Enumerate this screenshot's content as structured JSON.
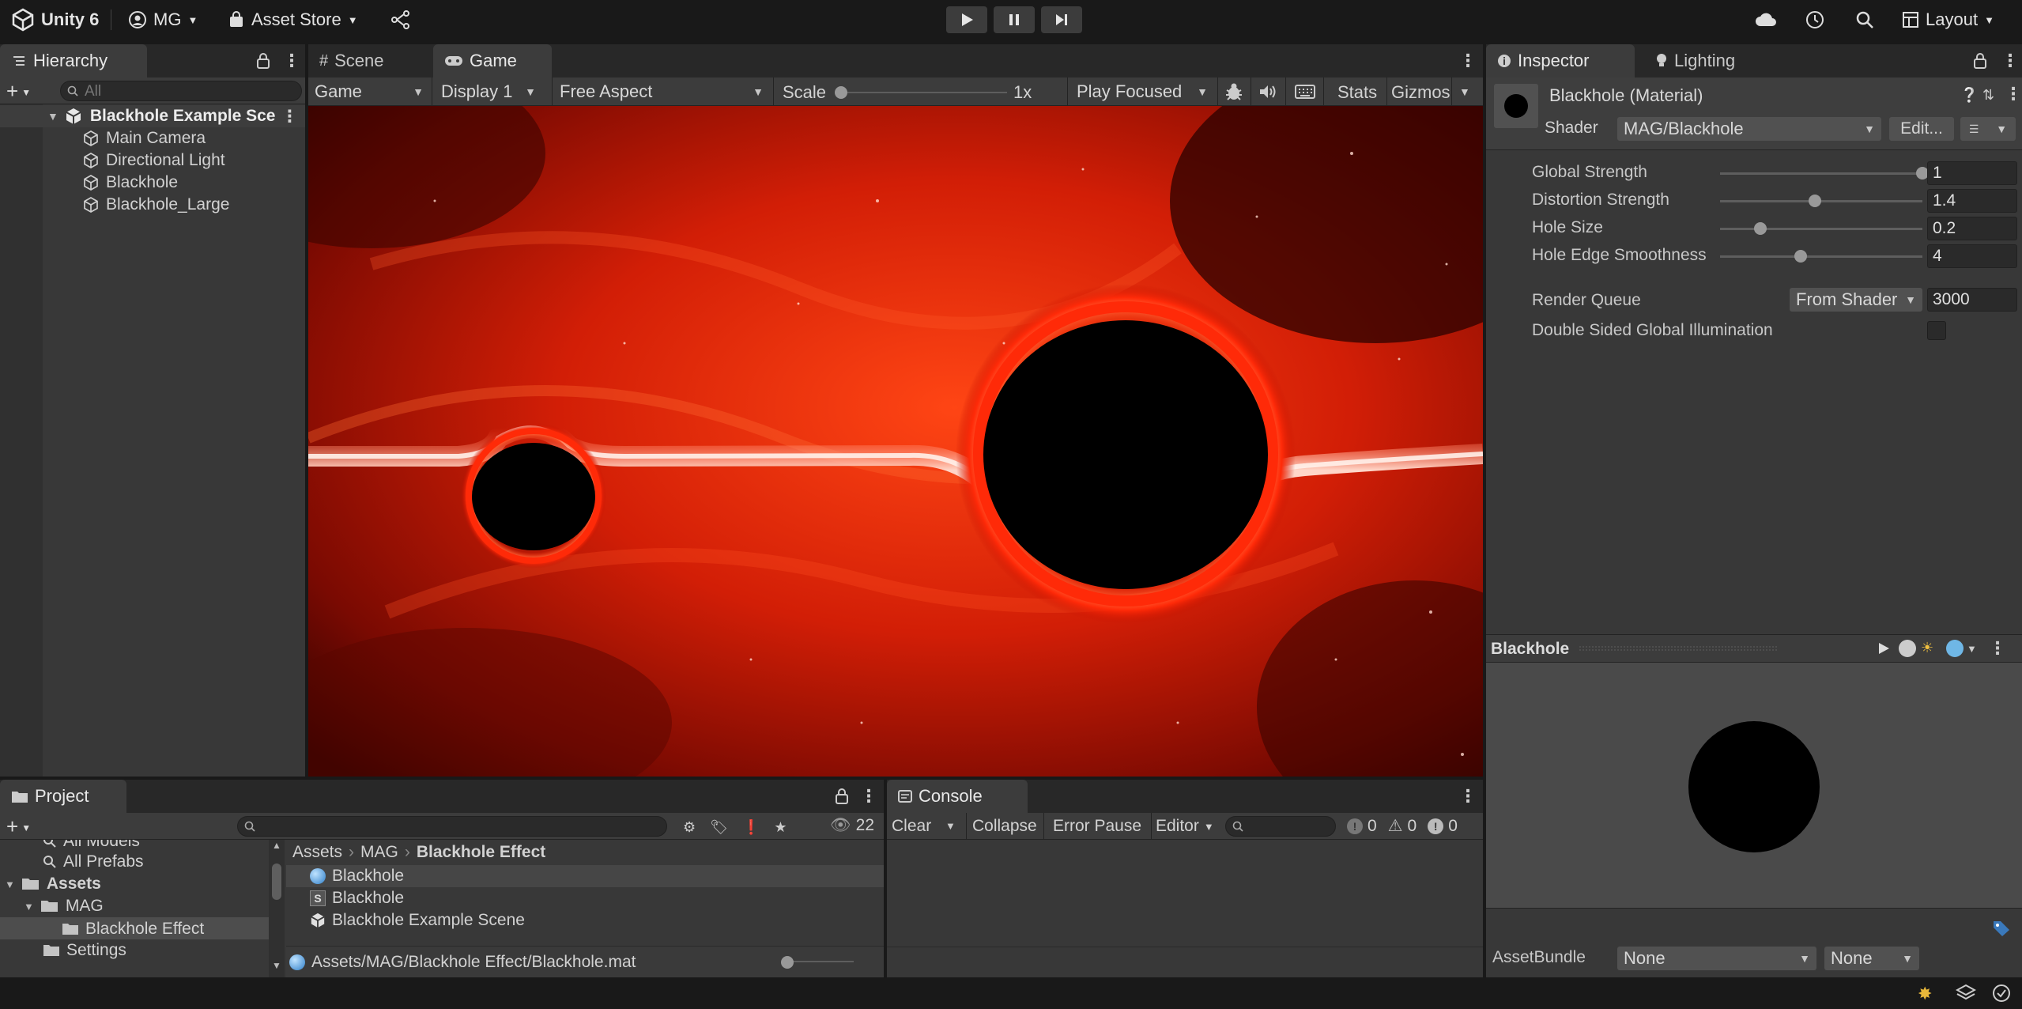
{
  "app": {
    "title": "Unity 6",
    "account": "MG",
    "asset_store": "Asset Store",
    "layout": "Layout"
  },
  "hierarchy": {
    "tab": "Hierarchy",
    "search_placeholder": "All",
    "scene": "Blackhole Example Sce",
    "items": [
      "Main Camera",
      "Directional Light",
      "Blackhole",
      "Blackhole_Large"
    ]
  },
  "center": {
    "tabs": [
      "Scene",
      "Game"
    ],
    "toolbar": {
      "view": "Game",
      "display": "Display 1",
      "aspect": "Free Aspect",
      "scale_label": "Scale",
      "scale_value": "1x",
      "play_mode": "Play Focused",
      "stats": "Stats",
      "gizmos": "Gizmos"
    }
  },
  "inspector": {
    "tabs": [
      "Inspector",
      "Lighting"
    ],
    "material_title": "Blackhole (Material)",
    "shader_label": "Shader",
    "shader_value": "MAG/Blackhole",
    "edit_button": "Edit...",
    "properties": [
      {
        "label": "Global Strength",
        "value": "1",
        "fraction": 1.0
      },
      {
        "label": "Distortion Strength",
        "value": "1.4",
        "fraction": 0.47
      },
      {
        "label": "Hole Size",
        "value": "0.2",
        "fraction": 0.2
      },
      {
        "label": "Hole Edge Smoothness",
        "value": "4",
        "fraction": 0.4
      }
    ],
    "render_queue_label": "Render Queue",
    "render_queue_mode": "From Shader",
    "render_queue_value": "3000",
    "double_sided_label": "Double Sided Global Illumination",
    "double_sided_checked": false,
    "preview_title": "Blackhole",
    "assetbundle_label": "AssetBundle",
    "assetbundle_name": "None",
    "assetbundle_variant": "None"
  },
  "project": {
    "tab": "Project",
    "count": "22",
    "favorites": [
      "All Models",
      "All Prefabs"
    ],
    "tree": [
      "Assets",
      "MAG",
      "Blackhole Effect",
      "Settings"
    ],
    "breadcrumb": [
      "Assets",
      "MAG",
      "Blackhole Effect"
    ],
    "files": [
      {
        "name": "Blackhole",
        "icon": "material-icon"
      },
      {
        "name": "Blackhole",
        "icon": "shader-icon"
      },
      {
        "name": "Blackhole Example Scene",
        "icon": "scene-icon"
      }
    ],
    "selected_path": "Assets/MAG/Blackhole Effect/Blackhole.mat"
  },
  "console": {
    "tab": "Console",
    "clear": "Clear",
    "collapse": "Collapse",
    "error_pause": "Error Pause",
    "editor": "Editor",
    "log_count": "0",
    "warning_count": "0",
    "error_count": "0"
  },
  "colors": {
    "accent": "#3a79bb",
    "selection": "#2c5d87",
    "panel": "#383838"
  }
}
